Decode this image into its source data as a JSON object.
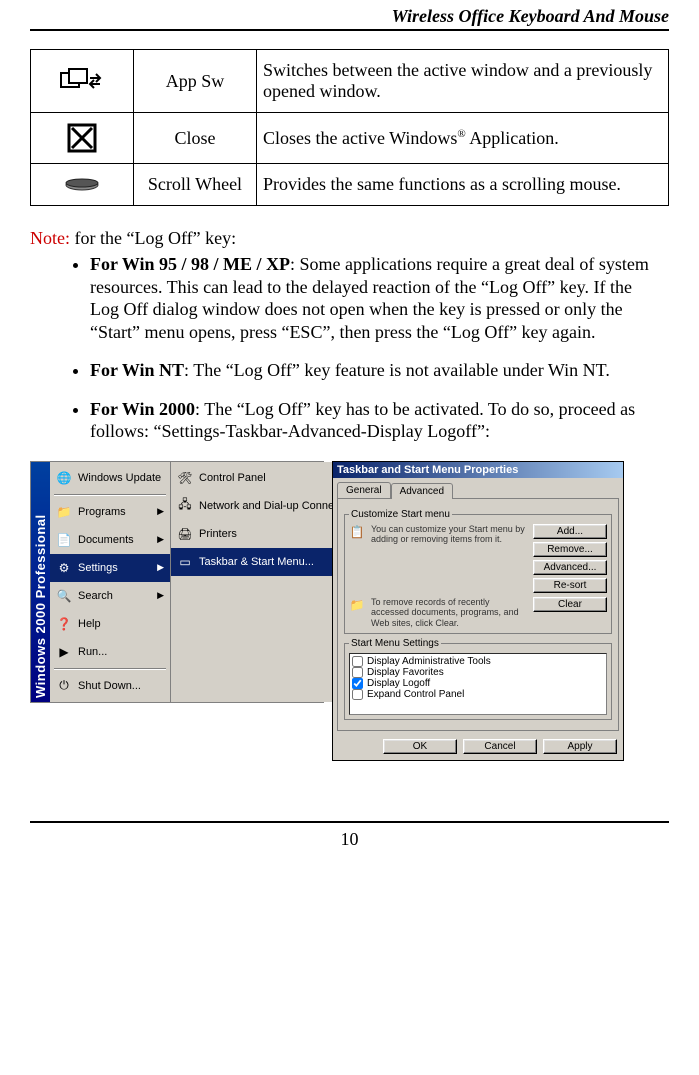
{
  "header": {
    "title": "Wireless Office Keyboard And Mouse"
  },
  "table": {
    "rows": [
      {
        "icon": "app-switch-icon",
        "name": "App Sw",
        "desc": "Switches between the active window and a previously opened window."
      },
      {
        "icon": "close-icon",
        "name": "Close",
        "desc_prefix": "Closes the active Windows",
        "sup": "®",
        "desc_suffix": " Application."
      },
      {
        "icon": "scroll-wheel-icon",
        "name": "Scroll Wheel",
        "desc": "Provides the same functions as a scrolling mouse."
      }
    ]
  },
  "note": {
    "label": "Note:",
    "text": " for the “Log Off” key:"
  },
  "bullets": [
    {
      "bold": "For Win 95 / 98 / ME / XP",
      "text": ": Some applications require a great deal of system resources. This can lead to the delayed reaction of the “Log Off” key. If the Log Off dialog window does not open when the key is pressed or only the “Start” menu opens, press “ESC”, then press the “Log Off” key again."
    },
    {
      "bold": "For Win NT",
      "text": ": The “Log Off” key feature is not available under Win NT."
    },
    {
      "bold": "For Win 2000",
      "text": ": The “Log Off” key has to be activated. To do so, proceed as follows: “Settings-Taskbar-Advanced-Display Logoff”:"
    }
  ],
  "startmenu": {
    "banner": "Windows 2000 Professional",
    "col1": [
      {
        "label": "Windows Update"
      },
      {
        "label": "Programs",
        "arrow": true
      },
      {
        "label": "Documents",
        "arrow": true
      },
      {
        "label": "Settings",
        "arrow": true,
        "sel": true
      },
      {
        "label": "Search",
        "arrow": true
      },
      {
        "label": "Help"
      },
      {
        "label": "Run..."
      },
      {
        "label": "Shut Down..."
      }
    ],
    "col2": [
      {
        "label": "Control Panel"
      },
      {
        "label": "Network and Dial-up Connections"
      },
      {
        "label": "Printers"
      },
      {
        "label": "Taskbar & Start Menu...",
        "sel": true
      }
    ]
  },
  "dialog": {
    "title": "Taskbar and Start Menu Properties",
    "tabs": [
      {
        "label": "General"
      },
      {
        "label": "Advanced",
        "active": true
      }
    ],
    "group1": {
      "legend": "Customize Start menu",
      "text": "You can customize your Start menu by adding or removing items from it.",
      "buttons": [
        "Add...",
        "Remove...",
        "Advanced...",
        "Re-sort"
      ]
    },
    "group_clear": {
      "text": "To remove records of recently accessed documents, programs, and Web sites, click Clear.",
      "button": "Clear"
    },
    "group2": {
      "legend": "Start Menu Settings",
      "items": [
        {
          "label": "Display Administrative Tools",
          "checked": false
        },
        {
          "label": "Display Favorites",
          "checked": false
        },
        {
          "label": "Display Logoff",
          "checked": true
        },
        {
          "label": "Expand Control Panel",
          "checked": false
        }
      ]
    },
    "buttons": {
      "ok": "OK",
      "cancel": "Cancel",
      "apply": "Apply"
    }
  },
  "pagenum": "10"
}
